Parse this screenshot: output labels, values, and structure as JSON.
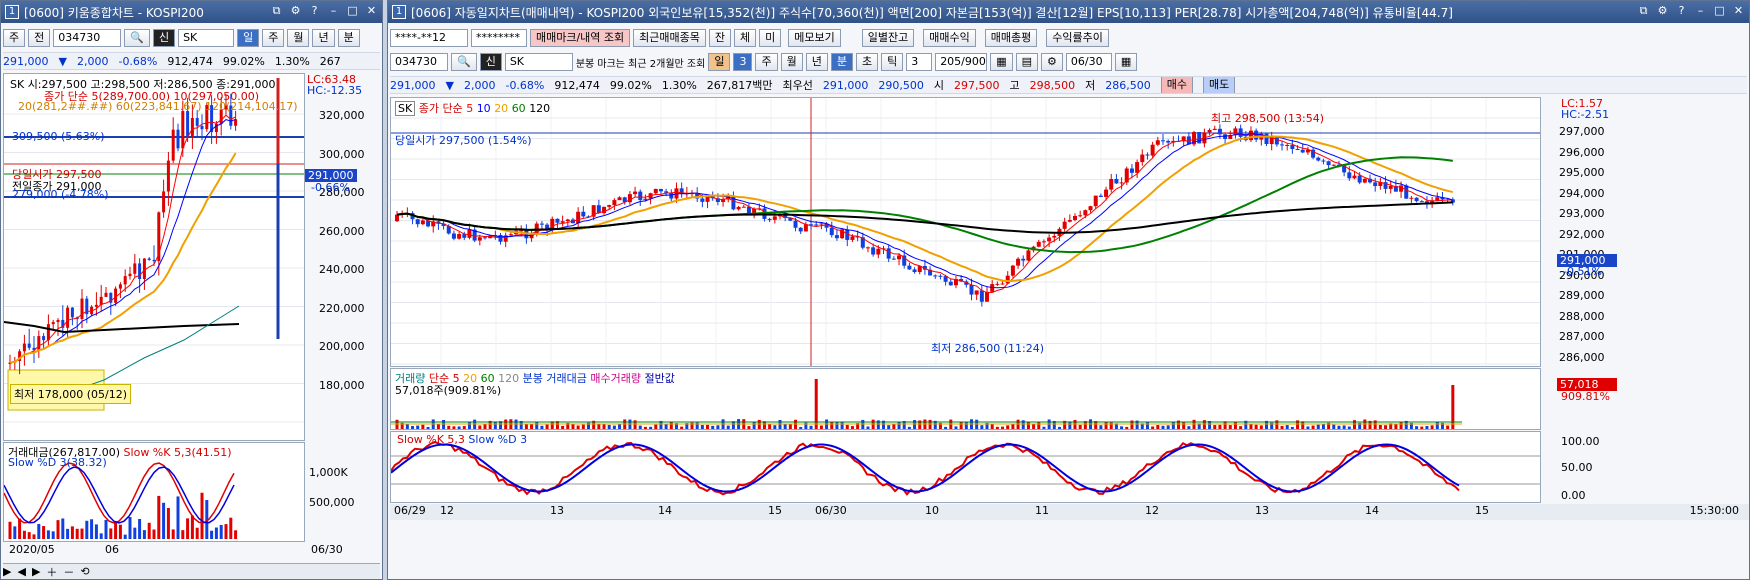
{
  "left_window": {
    "title": "[0600] 키움종합차트 - KOSPI200",
    "toolbar": {
      "period": "주",
      "prev": "전",
      "code": "034730",
      "name_prefix": "신",
      "name": "SK",
      "tabs": [
        "일",
        "주",
        "월",
        "년",
        "분"
      ]
    },
    "quote": {
      "price": "291,000",
      "change": "2,000",
      "rate": "-0.68%",
      "volume": "912,474",
      "ratio": "99.02%",
      "turnover": "1.30%",
      "extra": "267"
    },
    "legend_line1": "SK 시:297,500 고:298,500 저:286,500 종:291,000",
    "legend_line2": "종가 단순 5(289,700.00) 10(297,050.00)",
    "legend_line3": "20(281,2##.##) 60(223,841.67) 120(214,104.17)",
    "lc": "LC:63.48",
    "hc": "HC:-12.35",
    "tag_309": "309,500 (5.63%)",
    "tag_open": "당일시가 297,500",
    "tag_prev": "전일종가 291,000",
    "tag_279": "279,000 (-4.78%)",
    "tag_low": "최저 178,000 (05/12)",
    "price_label": "291,000",
    "price_rate": "-0.66%",
    "y_ticks": [
      "320,000",
      "300,000",
      "280,000",
      "260,000",
      "240,000",
      "220,000",
      "200,000",
      "180,000"
    ],
    "vol_legend_1": "거래대금(267,817.00)",
    "vol_legend_2": "Slow %K 5,3(41.51)",
    "vol_legend_3": "Slow %D 3(38.32)",
    "vol_ticks": [
      "1,000K",
      "500,000"
    ],
    "x_labels": [
      "2020/05",
      "06"
    ],
    "x_right": "06/30"
  },
  "right_window": {
    "title": "[0606] 자동일지차트(매매내역) - KOSPI200 외국인보유[15,352(천)] 주식수[70,360(천)] 액면[200] 자본금[153(억)] 결산[12월] EPS[10,113] PER[28.78] 시가총액[204,748(억)] 유통비율[44.7]",
    "toolbar1": {
      "account": "****-**12",
      "password": "********",
      "btn_mark": "매매마크/내역 조회",
      "btn_recent": "최근매매종목",
      "btn_jan": "잔",
      "btn_che": "체",
      "btn_mi": "미",
      "btn_memo": "메모보기",
      "btn_daily": "일별잔고",
      "btn_profit": "매매수익",
      "btn_total": "매매총평",
      "btn_rate": "수익률추이"
    },
    "toolbar2": {
      "code": "034730",
      "name_prefix": "신",
      "name": "SK",
      "note": "분봉 마크는 최근 2개월만 조회",
      "tabs": [
        "일",
        "3",
        "주",
        "월",
        "년",
        "분",
        "초",
        "틱"
      ],
      "interval": "3",
      "count": "205/900",
      "date": "06/30"
    },
    "quote": {
      "price": "291,000",
      "change": "2,000",
      "rate": "-0.68%",
      "volume": "912,474",
      "ratio": "99.02%",
      "turnover": "1.30%",
      "amount": "267,817백만",
      "priority_label": "최우선",
      "ask": "291,000",
      "bid": "290,500",
      "open_label": "시",
      "open": "297,500",
      "high_label": "고",
      "high": "298,500",
      "low_label": "저",
      "low": "286,500",
      "buy": "매수",
      "sell": "매도"
    },
    "legend": {
      "name": "SK",
      "ma": "종가 단순",
      "ma_periods": [
        "5",
        "10",
        "20",
        "60",
        "120"
      ]
    },
    "lc": "LC:1.57",
    "hc": "HC:-2.51",
    "tag_high": "최고 298,500 (13:54)",
    "tag_open": "당일시가 297,500 (1.54%)",
    "tag_low": "최저 286,500 (11:24)",
    "price_label": "291,000",
    "price_rate": "-0.51%",
    "y_ticks": [
      "297,000",
      "296,000",
      "295,000",
      "294,000",
      "293,000",
      "292,000",
      "291,000",
      "290,000",
      "289,000",
      "288,000",
      "287,000",
      "286,000"
    ],
    "vol_legend": {
      "label": "거래량",
      "ma": "단순",
      "periods": [
        "5",
        "20",
        "60",
        "120"
      ],
      "minute_amount": "분봉 거래대금",
      "buy_vol": "매수거래량",
      "half": "절반값",
      "value": "57,018주(909.81%)"
    },
    "vol_tag": "57,018",
    "vol_tag_rate": "909.81%",
    "stoch_legend_k": "Slow %K 5,3",
    "stoch_legend_d": "Slow %D 3",
    "stoch_ticks": [
      "100.00",
      "50.00",
      "0.00"
    ],
    "x_labels": [
      "06/29",
      "12",
      "13",
      "14",
      "15",
      "06/30",
      "10",
      "11",
      "12",
      "13",
      "14",
      "15"
    ],
    "x_time": "15:30:00"
  },
  "colors": {
    "up": "#e00000",
    "down": "#1040e0",
    "ma5": "#ff0000",
    "ma10": "#0000ff",
    "ma20": "#f0a000",
    "ma60": "#008000",
    "ma120": "#000000"
  }
}
